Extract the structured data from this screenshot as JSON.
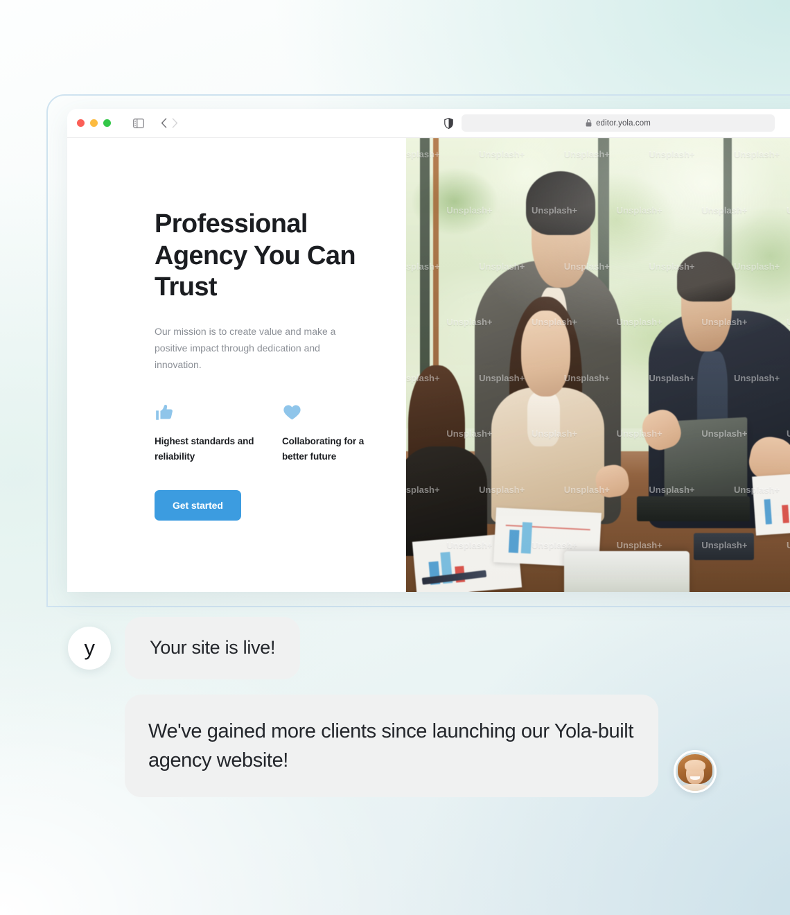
{
  "browser": {
    "url": "editor.yola.com",
    "lock_icon": "lock-icon",
    "shield_icon": "shield-icon",
    "reload_icon": "reload-icon",
    "sidebar_icon": "sidebar-toggle-icon",
    "back_icon": "chevron-left-icon",
    "forward_icon": "chevron-right-icon",
    "traffic_lights": [
      "close-red",
      "minimize-yellow",
      "maximize-green"
    ]
  },
  "site": {
    "headline": "Professional Agency You Can Trust",
    "subtext": "Our mission is to create value and make a positive impact through dedication and innovation.",
    "features": [
      {
        "icon": "thumbs-up-icon",
        "label": "Highest standards and reliability"
      },
      {
        "icon": "heart-icon",
        "label": "Collaborating for a better future"
      }
    ],
    "cta_label": "Get started",
    "hero_image_alt": "Business team collaborating around a desk with documents and a laptop",
    "hero_watermark": "Unsplash+"
  },
  "chat": {
    "brand_initial": "y",
    "messages": [
      {
        "author": "yola",
        "text": "Your site is live!"
      },
      {
        "author": "customer",
        "text": "We've gained more clients since launching our Yola-built agency website!"
      }
    ]
  },
  "colors": {
    "accent_blue": "#3c9ce0",
    "feature_icon_blue": "#8fc5ea",
    "bubble_gray": "#f0f1f1",
    "heading_dark": "#1b1d21",
    "body_gray": "#8b8f96",
    "frame_border": "#cfe3f0"
  }
}
